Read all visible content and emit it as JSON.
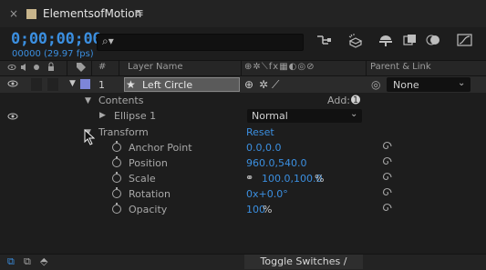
{
  "tab": {
    "close": "×",
    "title": "ElementsofMotion",
    "menu": "≡"
  },
  "timecode": {
    "value": "0;00;00;00",
    "sub": "00000 (29.97 fps)"
  },
  "search": {
    "placeholder": "",
    "icon_label": "⌕▾"
  },
  "header": {
    "number": "#",
    "layer_name": "Layer Name",
    "parent": "Parent & Link",
    "switch_icons": "⊕✲⟍fx▦◐◎⊘"
  },
  "layer": {
    "index": "1",
    "name": "Left Circle",
    "parent_value": "None"
  },
  "contents": {
    "label": "Contents",
    "add_label": "Add:"
  },
  "ellipse": {
    "label": "Ellipse 1",
    "blend_mode": "Normal"
  },
  "transform": {
    "label": "Transform",
    "reset_label": "Reset"
  },
  "properties": [
    {
      "name": "Anchor Point",
      "value": "0.0,0.0"
    },
    {
      "name": "Position",
      "value": "960.0,540.0"
    },
    {
      "name": "Scale",
      "value": "100.0,100.0",
      "unit": "%"
    },
    {
      "name": "Rotation",
      "value": "0x+0.0°"
    },
    {
      "name": "Opacity",
      "value": "100",
      "unit": "%"
    }
  ],
  "footer": {
    "toggle_label": "Toggle Switches / Modes"
  },
  "colors": {
    "accent": "#3b8fe0",
    "layer_label": "#7d86d9",
    "tab_swatch": "#c8b58c"
  }
}
